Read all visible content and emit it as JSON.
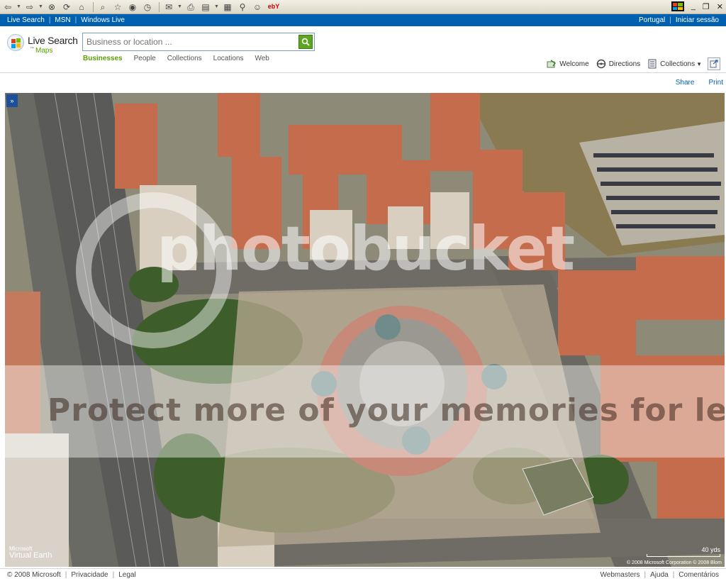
{
  "browser_toolbar": {
    "icons": [
      "back-icon",
      "forward-icon",
      "stop-icon",
      "refresh-icon",
      "home-icon",
      "search-icon",
      "favorites-icon",
      "history-icon",
      "media-icon",
      "mail-icon",
      "print-icon",
      "edit-icon",
      "discuss-icon",
      "messenger-icon",
      "ebay-icon"
    ],
    "ebay_label": "ebY",
    "window_controls": [
      "_",
      "❐",
      "✕"
    ]
  },
  "top_bar": {
    "links": [
      "Live Search",
      "MSN",
      "Windows Live"
    ],
    "right_links": [
      "Portugal",
      "Iniciar sessão"
    ],
    "bg_color": "#0060b0"
  },
  "logo": {
    "title": "Live Search",
    "tm": "™",
    "subtitle": "Maps"
  },
  "search": {
    "placeholder": "Business or location ...",
    "value": "",
    "button_color": "#5ea521"
  },
  "search_tabs": [
    {
      "label": "Businesses",
      "active": true
    },
    {
      "label": "People",
      "active": false
    },
    {
      "label": "Collections",
      "active": false
    },
    {
      "label": "Locations",
      "active": false
    },
    {
      "label": "Web",
      "active": false
    }
  ],
  "tools": {
    "welcome": "Welcome",
    "directions": "Directions",
    "collections": "Collections"
  },
  "share": "Share",
  "print": "Print",
  "map": {
    "collapse_label": "»",
    "watermark_logo": "photobucket",
    "watermark_text": "Protect more of your memories for less!",
    "ve_ms": "Microsoft",
    "ve_name": "Virtual Earth",
    "scale_label": "40 yds",
    "copyright": "© 2008 Microsoft Corporation   © 2008 Blom"
  },
  "footer": {
    "copyright": "© 2008 Microsoft",
    "left_links": [
      "Privacidade",
      "Legal"
    ],
    "right_links": [
      "Webmasters",
      "Ajuda",
      "Comentários"
    ]
  }
}
